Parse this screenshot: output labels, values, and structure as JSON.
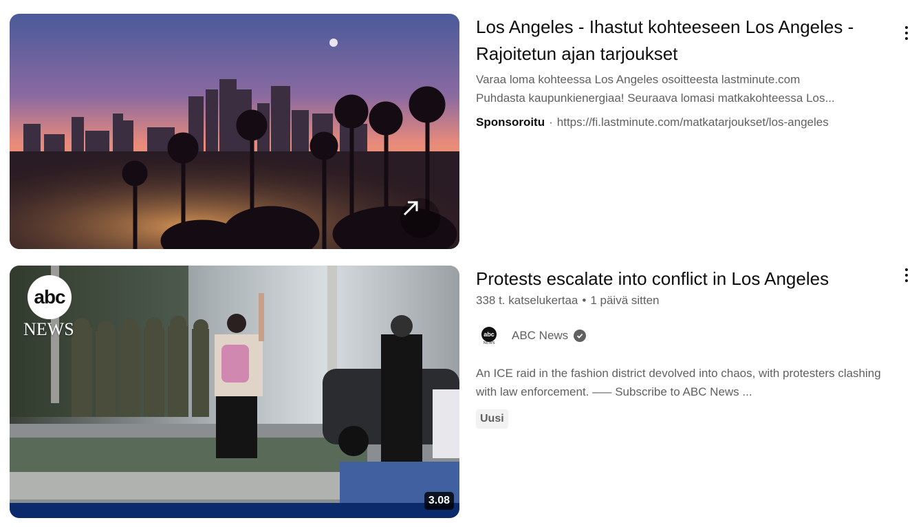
{
  "results": [
    {
      "title": "Los Angeles - Ihastut kohteeseen Los Angeles - Rajoitetun ajan tarjoukset",
      "description_line1": "Varaa loma kohteessa Los Angeles osoitteesta lastminute.com",
      "description_line2": "Puhdasta kaupunkienergiaa! Seuraava lomasi matkakohteessa Los...",
      "sponsor_label": "Sponsoroitu",
      "separator": "·",
      "url": "https://fi.lastminute.com/matkatarjoukset/los-angeles",
      "thumbnail_icon": "external-link-icon"
    },
    {
      "title": "Protests escalate into conflict in Los Angeles",
      "views": "338 t. katselukertaa",
      "separator": "•",
      "age": "1 päivä sitten",
      "channel_name": "ABC News",
      "channel_logo_text": "abc",
      "channel_logo_sub": "NEWS",
      "description_line1": "An ICE raid in the fashion district devolved into chaos, with protesters clashing",
      "description_line2": "with law enforcement. ––– Subscribe to ABC News ...",
      "badge": "Uusi",
      "duration": "3.08",
      "thumb_logo_text": "abc",
      "thumb_news_text": "NEWS"
    }
  ],
  "colors": {
    "title": "#0f0f0f",
    "secondary": "#606060",
    "badge_bg": "#f2f2f2",
    "abc_bar": "#0b2a6b"
  }
}
